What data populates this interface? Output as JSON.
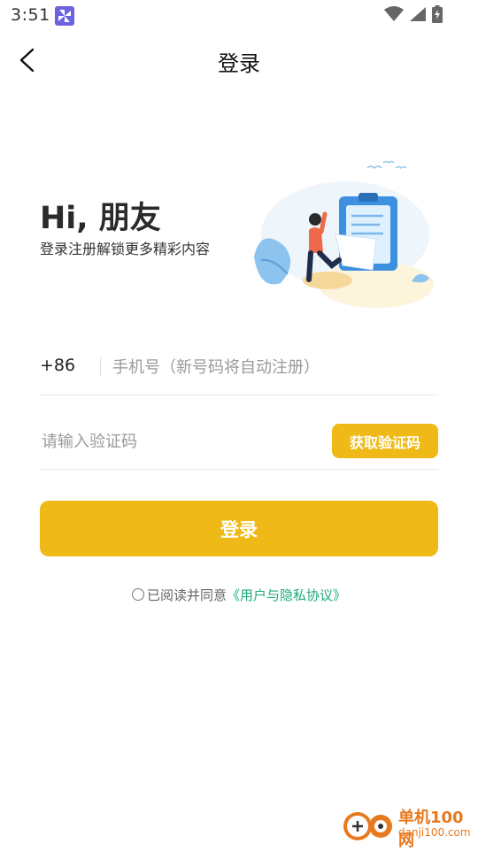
{
  "status_bar": {
    "time": "3:51",
    "app_badge_icon": "pinwheel-app-icon",
    "icons": [
      "wifi-icon",
      "signal-icon",
      "battery-charging-icon"
    ]
  },
  "navbar": {
    "back_icon": "chevron-left-icon",
    "title": "登录"
  },
  "hero": {
    "title": "Hi, 朋友",
    "subtitle": "登录注册解锁更多精彩内容",
    "illustration": "person-with-clipboard-illustration"
  },
  "form": {
    "country_code": "+86",
    "phone_placeholder": "手机号（新号码将自动注册）",
    "phone_value": "",
    "code_placeholder": "请输入验证码",
    "code_value": "",
    "get_code_label": "获取验证码"
  },
  "login_label": "登录",
  "agreement": {
    "prefix": "已阅读并同意",
    "link": "《用户与隐私协议》",
    "checked": false
  },
  "watermark": {
    "name": "单机100网",
    "domain": "danji100.com"
  },
  "colors": {
    "accent": "#efba17",
    "link": "#1ea97c",
    "watermark": "#e87a1e"
  }
}
